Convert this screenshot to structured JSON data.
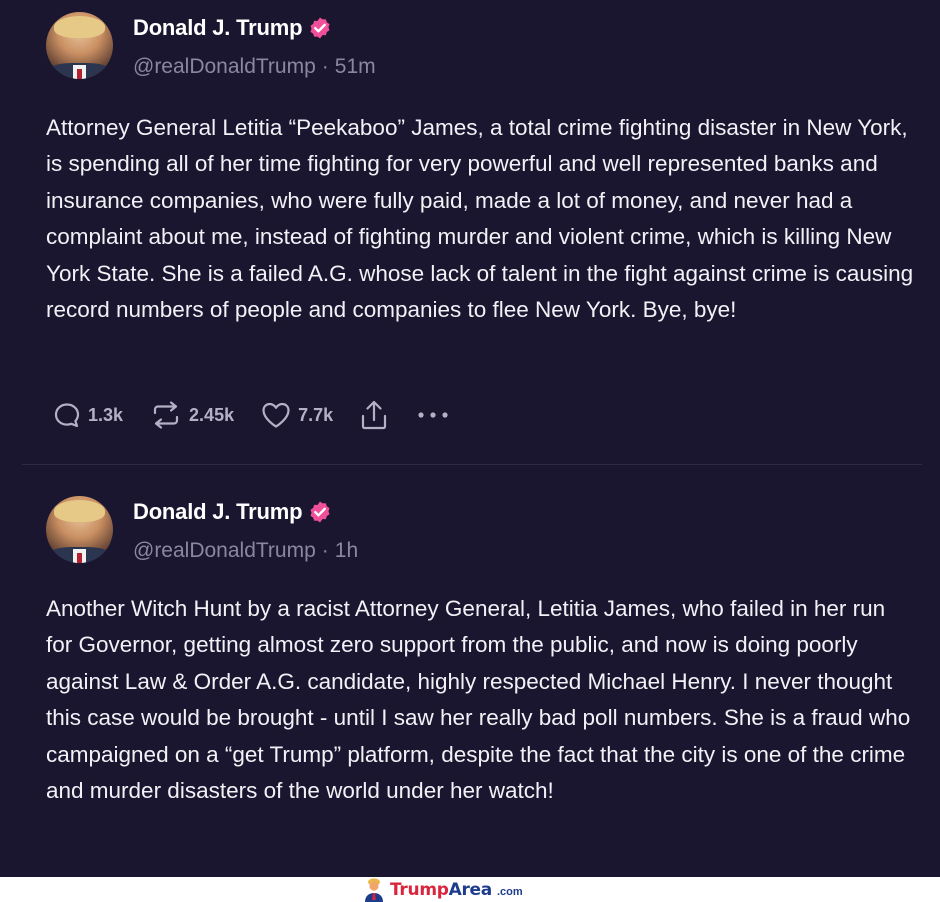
{
  "posts": [
    {
      "author": "Donald J. Trump",
      "handle": "@realDonaldTrump",
      "separator": "·",
      "time": "51m",
      "text": "Attorney General Letitia “Peekaboo” James, a total crime fighting disaster in New York, is spending all of her time fighting for very powerful and well represented banks and insurance companies, who were fully paid, made a lot of money, and never had a complaint about me, instead of fighting murder and violent crime, which is killing New York State. She is a failed A.G. whose lack of talent in the fight against crime is causing record numbers of people and companies to flee New York. Bye, bye!",
      "replies": "1.3k",
      "reposts": "2.45k",
      "likes": "7.7k"
    },
    {
      "author": "Donald J. Trump",
      "handle": "@realDonaldTrump",
      "separator": "·",
      "time": "1h",
      "text": "Another Witch Hunt by a racist Attorney General, Letitia James, who failed in her run for Governor, getting almost zero support from the public, and now is doing poorly against Law & Order A.G. candidate, highly respected Michael Henry. I never thought this case would be brought - until I saw her really bad poll numbers. She is a fraud who campaigned on a “get Trump” platform, despite the fact that the city is one of the crime and murder disasters of the world under her watch!"
    }
  ],
  "footer": {
    "brand_part1": "Trump",
    "brand_part2": "Area",
    "brand_tld": ".com"
  },
  "colors": {
    "background": "#1a1630",
    "text": "#f2f1f6",
    "muted": "#8b87a0",
    "verified_badge": "#f0509a",
    "brand_red": "#d7263d",
    "brand_blue": "#1e3c8c"
  },
  "icons": {
    "verified": "verified-badge-icon",
    "reply": "reply-icon",
    "repost": "repost-icon",
    "like": "heart-icon",
    "share": "share-icon",
    "more": "more-icon",
    "mascot": "mascot-icon"
  }
}
